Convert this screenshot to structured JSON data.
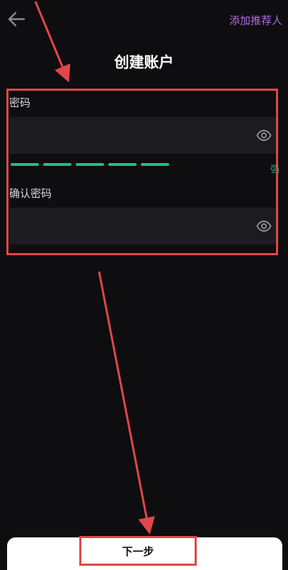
{
  "header": {
    "back_icon": "arrow-left-icon",
    "referrer_link": "添加推荐人",
    "title": "创建账户"
  },
  "form": {
    "password": {
      "label": "密码",
      "value": "",
      "placeholder": "",
      "toggle_icon": "eye-icon"
    },
    "strength": {
      "level": 5,
      "max": 5,
      "text": "强",
      "color": "#1fbf85"
    },
    "confirm_password": {
      "label": "确认密码",
      "value": "",
      "placeholder": "",
      "toggle_icon": "eye-icon"
    }
  },
  "footer": {
    "next_label": "下一步"
  },
  "colors": {
    "background": "#0e0d10",
    "input_bg": "#1c1c20",
    "accent_purple": "#b26ae0",
    "strength_green": "#1fbf85",
    "annotation_red": "#e0474a"
  }
}
